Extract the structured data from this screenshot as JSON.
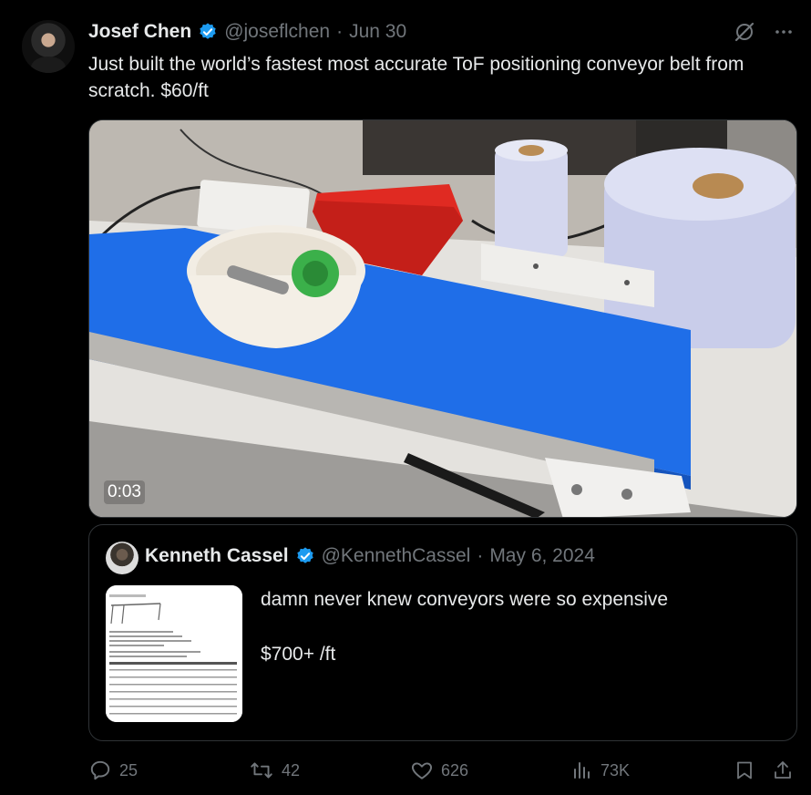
{
  "tweet": {
    "author_name": "Josef Chen",
    "handle": "@joseflchen",
    "separator": "·",
    "date": "Jun 30",
    "text": "Just built the world’s fastest most accurate ToF positioning conveyor belt from scratch. $60/ft",
    "video_time": "0:03"
  },
  "quote": {
    "author_name": "Kenneth Cassel",
    "handle": "@KennethCassel",
    "separator": "·",
    "date": "May 6, 2024",
    "line1": "damn never knew conveyors were so expensive",
    "line2": "$700+ /ft"
  },
  "actions": {
    "replies": "25",
    "reposts": "42",
    "likes": "626",
    "views": "73K"
  },
  "colors": {
    "background": "#000000",
    "text_primary": "#e7e9ea",
    "text_secondary": "#71767b",
    "border": "#2f3336",
    "verified": "#1d9bf0",
    "belt_blue": "#1f6ee8"
  },
  "icons": [
    "grok-icon",
    "more-icon",
    "verified-icon",
    "reply-icon",
    "repost-icon",
    "like-icon",
    "views-icon",
    "bookmark-icon",
    "share-icon"
  ]
}
